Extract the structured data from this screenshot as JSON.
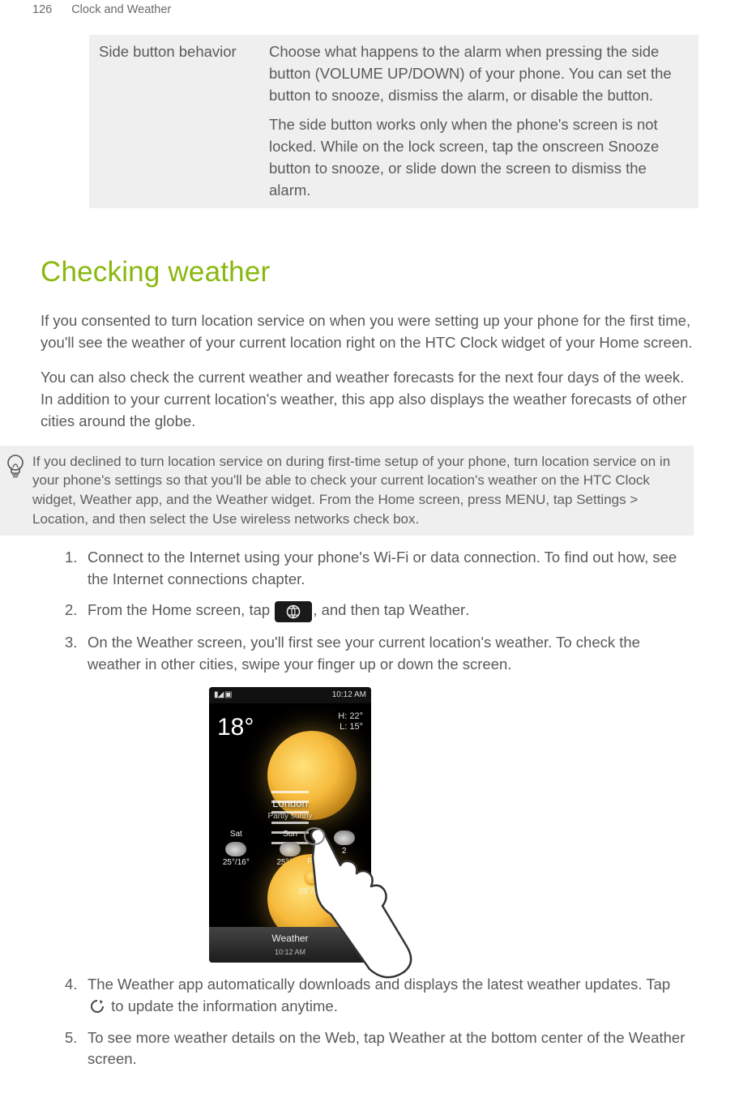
{
  "page": {
    "number": "126",
    "section": "Clock and Weather"
  },
  "table": {
    "label": "Side button behavior",
    "p1": "Choose what happens to the alarm when pressing the side button (VOLUME UP/DOWN) of your phone. You can set the button to snooze, dismiss the alarm, or disable the button.",
    "p2a": "The side button works only when the phone's screen is not locked. While on the lock screen, tap the onscreen ",
    "p2b": "Snooze",
    "p2c": " button to snooze, or slide down the screen to dismiss the alarm."
  },
  "heading": "Checking weather",
  "para1": "If you consented to turn location service on when you were setting up your phone for the first time, you'll see the weather of your current location right on the HTC Clock widget of your Home screen.",
  "para2": "You can also check the current weather and weather forecasts for the next four days of the week. In addition to your current location's weather, this app also displays the weather forecasts of other cities around the globe.",
  "tip": {
    "a": "If you declined to turn location service on during first-time setup of your phone, turn location service on in your phone's settings so that you'll be able to check your current location's weather on the HTC Clock widget, Weather app, and the Weather widget. From the Home screen, press MENU, tap ",
    "b": "Settings > Location",
    "c": ", and then select the ",
    "d": "Use wireless networks",
    "e": " check box."
  },
  "steps": {
    "s1": "Connect to the Internet using your phone's Wi-Fi or data connection. To find out how, see the Internet connections chapter.",
    "s2a": "From the Home screen, tap ",
    "s2b": ", and then tap ",
    "s2c": "Weather",
    "s2d": ".",
    "s3": "On the Weather screen, you'll first see your current location's weather. To check the weather in other cities, swipe your finger up or down the screen.",
    "s4a": "The Weather app automatically downloads and displays the latest weather updates. Tap ",
    "s4b": " to update the information anytime.",
    "s5a": "To see more weather details on the Web, tap ",
    "s5b": "Weather",
    "s5c": " at the bottom center of the Weather screen."
  },
  "step_nums": {
    "n1": "1.",
    "n2": "2.",
    "n3": "3.",
    "n4": "4.",
    "n5": "5."
  },
  "fig": {
    "time": "10:12 AM",
    "signal_icons": "▮◢ ▣",
    "temp": "18°",
    "hi": "H: 22°",
    "lo": "L: 15°",
    "city": "London",
    "cond": "Partly sunny",
    "fc": [
      {
        "day": "Fri",
        "t": "23°/16°"
      },
      {
        "day": "Sat",
        "t": "25°/16°"
      },
      {
        "day": "Sun",
        "t": "25°/18°"
      },
      {
        "day": "",
        "t": "2"
      }
    ],
    "bottom_label": "Weather",
    "bottom_sub": "10:12 AM",
    "plus": "+"
  }
}
